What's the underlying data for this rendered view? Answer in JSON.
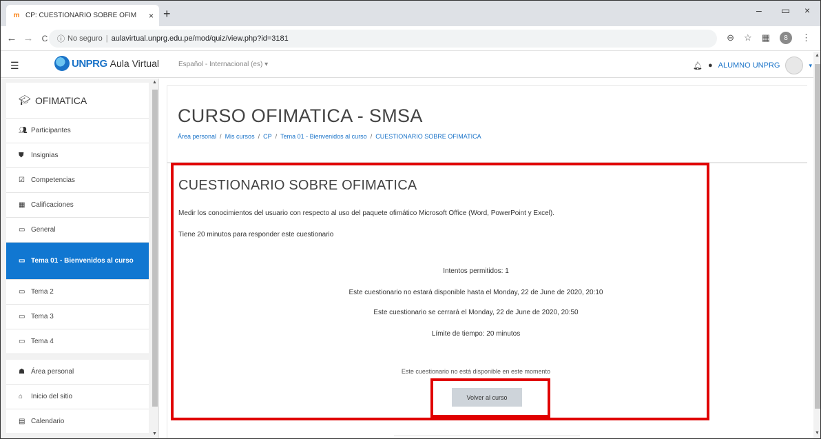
{
  "browser": {
    "tab_title": "CP: CUESTIONARIO SOBRE OFIM",
    "tab_close": "×",
    "new_tab": "+",
    "minimize": "–",
    "maximize": "▭",
    "close": "×",
    "back": "←",
    "forward": "→",
    "reload": "C",
    "security_label": "No seguro",
    "url": "aulavirtual.unprg.edu.pe/mod/quiz/view.php?id=3181",
    "profile_initial": "8"
  },
  "navbar": {
    "brand_name": "UNPRG",
    "brand_suffix": "Aula Virtual",
    "language": "Español - Internacional (es) ▾",
    "user_name": "ALUMNO UNPRG"
  },
  "drawer": {
    "course": "OFIMATICA",
    "items": [
      {
        "icon": "participants-icon",
        "label": "Participantes"
      },
      {
        "icon": "badge-icon",
        "label": "Insignias"
      },
      {
        "icon": "competencies-icon",
        "label": "Competencias"
      },
      {
        "icon": "grades-icon",
        "label": "Calificaciones"
      },
      {
        "icon": "folder-icon",
        "label": "General"
      },
      {
        "icon": "folder-icon",
        "label": "Tema 01 - Bienvenidos al curso"
      },
      {
        "icon": "folder-icon",
        "label": "Tema 2"
      },
      {
        "icon": "folder-icon",
        "label": "Tema 3"
      },
      {
        "icon": "folder-icon",
        "label": "Tema 4"
      }
    ],
    "items2": [
      {
        "icon": "dashboard-icon",
        "label": "Área personal"
      },
      {
        "icon": "home-icon",
        "label": "Inicio del sitio"
      },
      {
        "icon": "calendar-icon",
        "label": "Calendario"
      }
    ]
  },
  "header": {
    "course_title": "CURSO OFIMATICA - SMSA",
    "breadcrumb": [
      "Área personal",
      "Mis cursos",
      "CP",
      "Tema 01 - Bienvenidos al curso",
      "CUESTIONARIO SOBRE OFIMATICA"
    ],
    "breadcrumb_sep": "/"
  },
  "quiz": {
    "title": "CUESTIONARIO SOBRE OFIMATICA",
    "description": "Medir los conocimientos del usuario con respecto al uso del paquete ofimático Microsoft Office (Word, PowerPoint y Excel).",
    "time_note": "Tiene 20 minutos para responder este cuestionario",
    "attempts": "Intentos permitidos: 1",
    "open_note": "Este cuestionario no estará disponible hasta el Monday, 22 de June de 2020, 20:10",
    "close_note": "Este cuestionario se cerrará el Monday, 22 de June de 2020, 20:50",
    "time_limit": "Límite de tiempo: 20 minutos",
    "unavailable": "Este cuestionario no está disponible en este momento",
    "back_button": "Volver al curso"
  },
  "colors": {
    "accent": "#1177d1",
    "annotation": "#e00000"
  }
}
